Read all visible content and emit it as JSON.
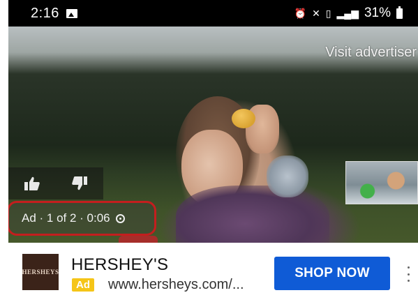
{
  "status_bar": {
    "time": "2:16",
    "battery_level": "31%",
    "icons": [
      "image-icon",
      "alarm-icon",
      "mute-icon",
      "vibrate-icon",
      "signal-icon",
      "battery-icon"
    ]
  },
  "video": {
    "visit_advertiser_label": "Visit advertiser",
    "ad_info": "Ad · 1 of 2 · 0:06",
    "like_icon": "thumbs-up-icon",
    "dislike_icon": "thumbs-down-icon",
    "highlight_color": "#c41e1e"
  },
  "ad_bar": {
    "logo_text": "HERSHEYS",
    "advertiser_name": "HERSHEY'S",
    "badge": "Ad",
    "url": "www.hersheys.com/...",
    "cta_label": "SHOP NOW",
    "cta_color": "#0f5bd6",
    "badge_color": "#f5c518"
  }
}
